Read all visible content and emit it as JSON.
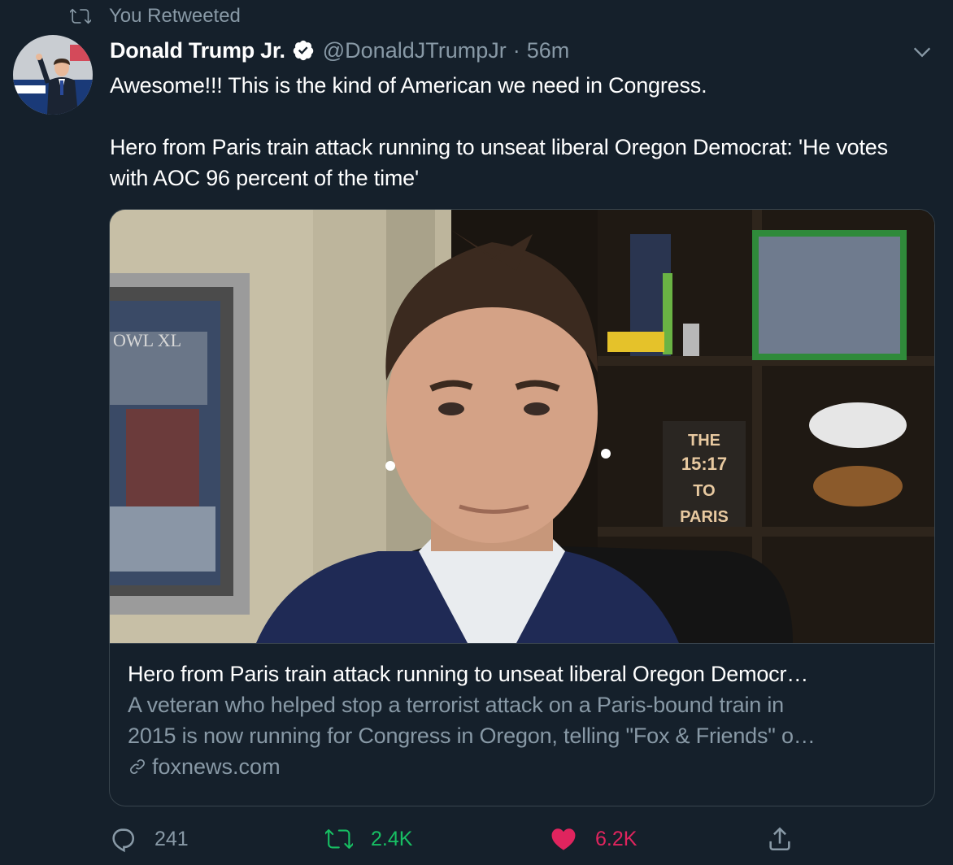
{
  "social_context": {
    "label": "You Retweeted",
    "icon": "retweet-icon"
  },
  "author": {
    "name": "Donald Trump Jr.",
    "handle": "@DonaldJTrumpJr",
    "separator": "·",
    "time": "56m",
    "verified": true
  },
  "tweet": {
    "line1": "Awesome!!! This is the kind of American we need in Congress.",
    "line2": "Hero from Paris train attack running to unseat liberal Oregon Democrat: 'He votes with AOC 96 percent of the time'"
  },
  "card": {
    "image_text": {
      "poster_line1": "THE",
      "poster_line2": "15:17",
      "poster_line3": "TO",
      "poster_line4": "PARIS",
      "frame_text": "OWL XL"
    },
    "title": "Hero from Paris train attack running to unseat liberal Oregon Democr…",
    "description_line1": "A veteran who helped stop a terrorist attack on a Paris-bound train in",
    "description_line2": "2015 is now running for Congress in Oregon, telling \"Fox & Friends\" o…",
    "domain": "foxnews.com"
  },
  "actions": {
    "reply_count": "241",
    "retweet_count": "2.4K",
    "like_count": "6.2K"
  },
  "colors": {
    "background": "#15202b",
    "secondary_text": "#8899a6",
    "retweet_active": "#17bf63",
    "like_active": "#e0245e",
    "border": "#38444d"
  }
}
